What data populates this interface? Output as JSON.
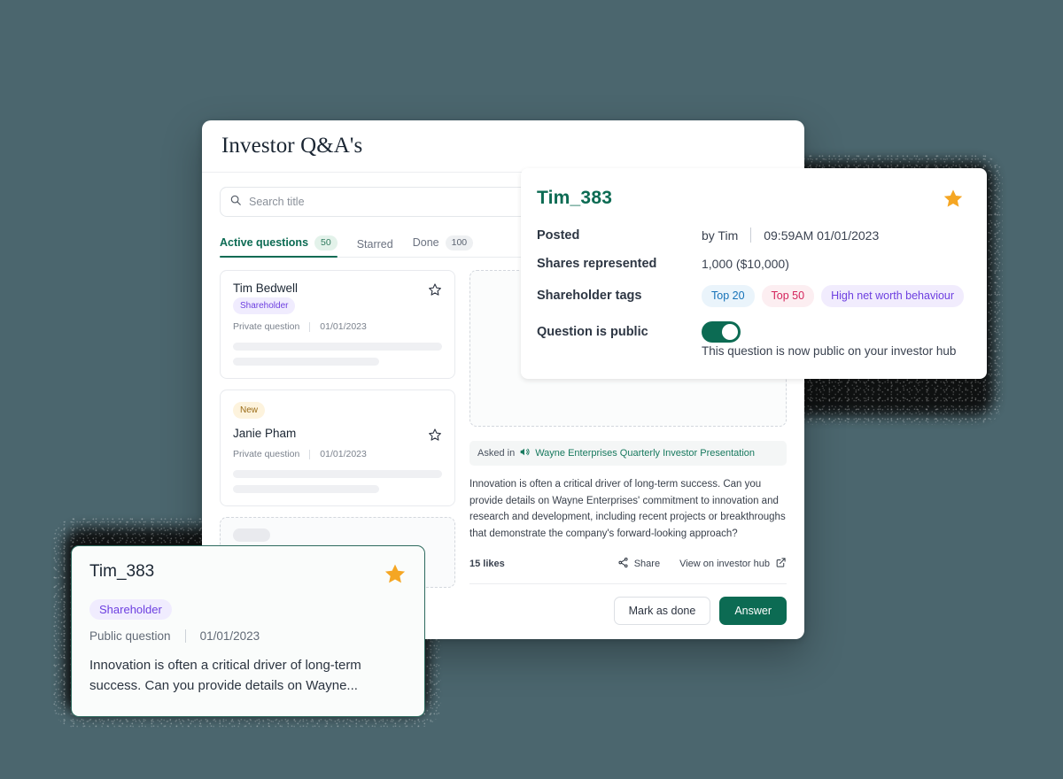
{
  "theme": {
    "page_background": "#4b666e",
    "brand_green": "#0c6b53",
    "star_gold": "#f5a623"
  },
  "app_window": {
    "title": "Investor Q&A's",
    "search": {
      "placeholder": "Search title",
      "value": "",
      "icon": "search-icon"
    },
    "tabs": [
      {
        "label": "Active questions",
        "count": "50",
        "active": true
      },
      {
        "label": "Starred",
        "count": "",
        "active": false
      },
      {
        "label": "Done",
        "count": "100",
        "active": false
      }
    ],
    "question_cards": [
      {
        "name": "Tim Bedwell",
        "badge": "",
        "tag": "Shareholder",
        "visibility": "Private question",
        "date": "01/01/2023",
        "star_icon": "star-outline-icon"
      },
      {
        "name": "Janie Pham",
        "badge": "New",
        "tag": "",
        "visibility": "Private question",
        "date": "01/01/2023",
        "star_icon": "star-outline-icon"
      }
    ],
    "detail": {
      "asked_in_label": "Asked in",
      "asked_in_icon": "megaphone-icon",
      "event_name": "Wayne Enterprises Quarterly Investor Presentation",
      "question_text": "Innovation is often a critical driver of long-term success. Can you provide details on Wayne Enterprises' commitment to innovation and research and development, including recent projects or breakthroughs that demonstrate the company's forward-looking approach?",
      "likes": "15 likes",
      "share_label": "Share",
      "share_icon": "share-icon",
      "view_hub_label": "View on investor hub",
      "view_hub_icon": "external-link-icon",
      "mark_done_label": "Mark as done",
      "answer_label": "Answer"
    }
  },
  "detail_popup": {
    "title": "Tim_383",
    "star_icon": "star-filled-icon",
    "rows": [
      {
        "key": "Posted",
        "author": "by Tim",
        "timestamp": "09:59AM 01/01/2023"
      },
      {
        "key": "Shares represented",
        "value": "1,000 ($10,000)"
      },
      {
        "key": "Shareholder tags"
      },
      {
        "key": "Question is public"
      }
    ],
    "posted_key": "Posted",
    "posted_author": "by Tim",
    "posted_timestamp": "09:59AM 01/01/2023",
    "shares_key": "Shares represented",
    "shares_value": "1,000 ($10,000)",
    "tags_key": "Shareholder tags",
    "tags": [
      {
        "label": "Top 20",
        "style": "blue"
      },
      {
        "label": "Top 50",
        "style": "pink"
      },
      {
        "label": "High net worth behaviour",
        "style": "purple"
      }
    ],
    "public_key": "Question is public",
    "public_toggle_on": true,
    "public_hint": "This question is now public on your investor hub"
  },
  "preview_card": {
    "name": "Tim_383",
    "star_icon": "star-filled-icon",
    "tag": "Shareholder",
    "visibility": "Public question",
    "date": "01/01/2023",
    "excerpt": "Innovation is often a critical driver of long-term success. Can you provide details on Wayne..."
  }
}
